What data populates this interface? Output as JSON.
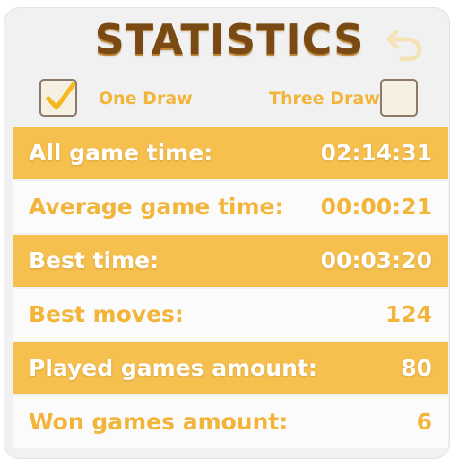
{
  "header": {
    "title": "STATISTICS",
    "back_icon": "back-arrow-icon"
  },
  "options": {
    "one_draw": {
      "label": "One Draw",
      "checked": true
    },
    "three_draw": {
      "label": "Three Draw",
      "checked": false
    }
  },
  "colors": {
    "title": "#7a4a15",
    "accent": "#f6c04f",
    "label_text": "#f2b53a",
    "background": "#f1f1f1"
  },
  "stats": [
    {
      "label": "All game time:",
      "value": "02:14:31"
    },
    {
      "label": "Average game time:",
      "value": "00:00:21"
    },
    {
      "label": "Best time:",
      "value": "00:03:20"
    },
    {
      "label": "Best moves:",
      "value": "124"
    },
    {
      "label": "Played games amount:",
      "value": "80"
    },
    {
      "label": "Won games amount:",
      "value": "6"
    }
  ]
}
